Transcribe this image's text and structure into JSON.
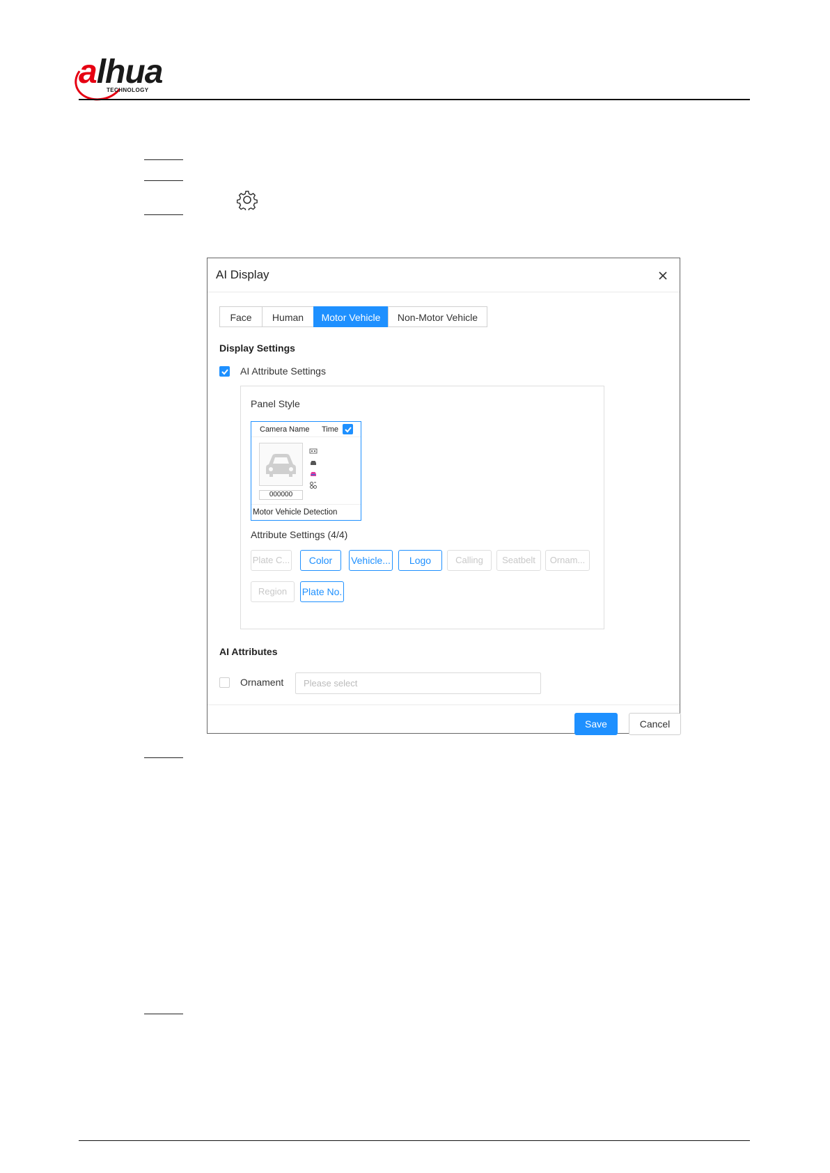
{
  "header": {
    "logo_text": "alhua",
    "logo_subtext": "TECHNOLOGY",
    "brand_red": "#e60012"
  },
  "dialog": {
    "title": "AI Display",
    "close_icon": "close-icon",
    "tabs": [
      {
        "label": "Face",
        "active": false
      },
      {
        "label": "Human",
        "active": false
      },
      {
        "label": "Motor Vehicle",
        "active": true
      },
      {
        "label": "Non-Motor Vehicle",
        "active": false
      }
    ],
    "display_settings": {
      "title": "Display Settings",
      "ai_attribute_settings": {
        "label": "AI Attribute Settings",
        "checked": true
      },
      "panel_style": {
        "label": "Panel Style",
        "camera_name": "Camera Name",
        "time_label": "Time",
        "time_checked": true,
        "plate_text": "000000",
        "caption": "Motor Vehicle Detection"
      },
      "attribute_settings": {
        "label": "Attribute Settings (4/4)",
        "chips": [
          {
            "label": "Plate C...",
            "selected": false
          },
          {
            "label": "Color",
            "selected": true
          },
          {
            "label": "Vehicle...",
            "selected": true
          },
          {
            "label": "Logo",
            "selected": true
          },
          {
            "label": "Calling",
            "selected": false
          },
          {
            "label": "Seatbelt",
            "selected": false
          },
          {
            "label": "Ornam...",
            "selected": false
          },
          {
            "label": "Region",
            "selected": false
          },
          {
            "label": "Plate No.",
            "selected": true
          }
        ]
      }
    },
    "ai_attributes": {
      "title": "AI Attributes",
      "ornament": {
        "label": "Ornament",
        "checked": false,
        "placeholder": "Please select"
      }
    },
    "buttons": {
      "save": "Save",
      "cancel": "Cancel"
    },
    "accent_color": "#1e90ff"
  }
}
